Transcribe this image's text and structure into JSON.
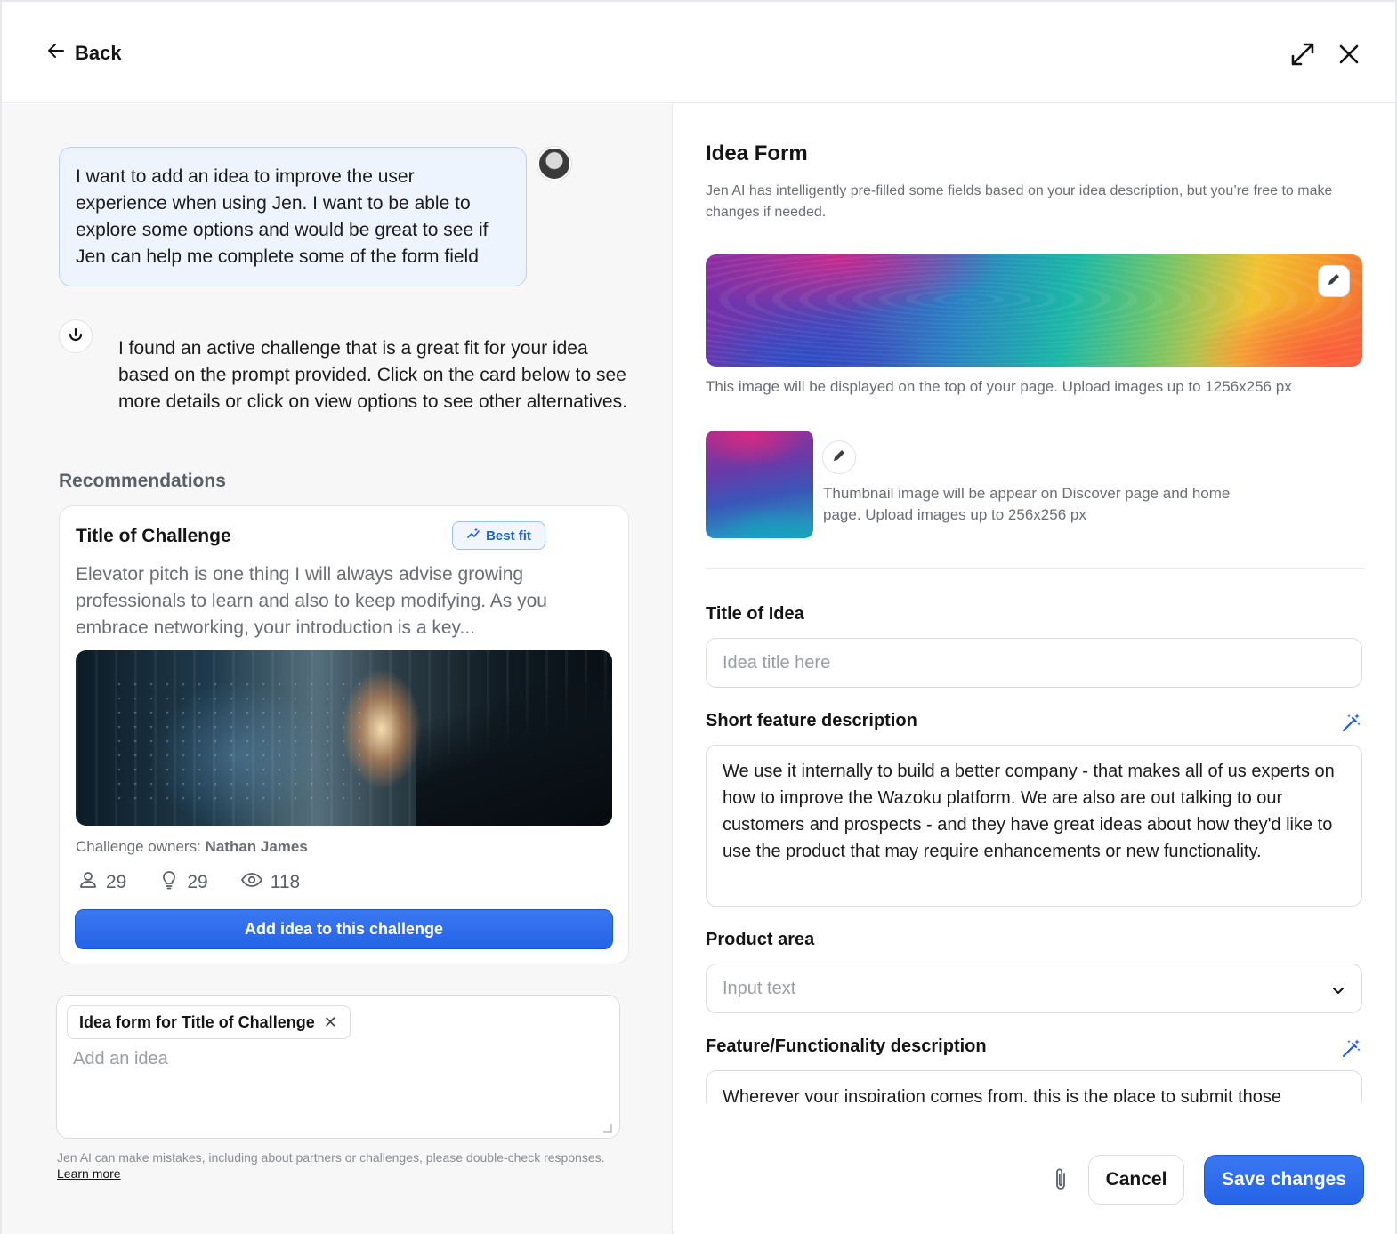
{
  "header": {
    "back_label": "Back",
    "icons": [
      "arrow-left-icon",
      "expand-icon",
      "close-icon"
    ]
  },
  "chat": {
    "user_message": "I want to add an idea to improve the user experience when using Jen. I want to be able to explore some options and would be great to see if Jen can help me complete some of the form field",
    "ai_message": "I found an active challenge that is a great fit for your idea based on the prompt provided. Click on the card below to see more details or click on view options to see other alternatives.",
    "recommendations_title": "Recommendations",
    "card": {
      "title": "Title of Challenge",
      "badge": "Best fit",
      "description": "Elevator pitch is one thing I will always advise growing professionals to learn and also to keep modifying. As you embrace networking, your introduction is a key...",
      "owners_label": "Challenge owners:",
      "owners_name": "Nathan James",
      "stats": {
        "participants": "29",
        "ideas": "29",
        "views": "118"
      },
      "button_label": "Add idea to this challenge"
    },
    "composer": {
      "chip_label": "Idea form for Title of Challenge",
      "placeholder": "Add an idea"
    },
    "disclaimer": "Jen AI can make mistakes, including about partners or challenges, please double-check responses.",
    "learn_more": "Learn more"
  },
  "form": {
    "title": "Idea Form",
    "subtitle": "Jen AI has intelligently pre-filled some fields based on your idea description, but you’re free to make changes if needed.",
    "banner_caption": "This image will be displayed on the top of your page. Upload images up to 1256x256 px",
    "thumbnail_caption": "Thumbnail image will be appear on Discover page and home page. Upload images up to 256x256 px",
    "fields": {
      "title_label": "Title of Idea",
      "title_placeholder": "Idea title here",
      "short_desc_label": "Short feature description",
      "short_desc_value": "We use it internally to build a better company - that makes all of us experts on how to improve the Wazoku platform. We are also are out talking to our customers and prospects - and they have great ideas about how they'd like to use the product that may require enhancements or new functionality.",
      "product_area_label": "Product area",
      "product_area_placeholder": "Input text",
      "feature_desc_label": "Feature/Functionality description",
      "feature_desc_value": "Wherever your inspiration comes from, this is the place to submit those"
    },
    "footer": {
      "cancel_label": "Cancel",
      "save_label": "Save changes"
    }
  },
  "colors": {
    "primary": "#2563e8",
    "bubble_bg": "#eef4fd",
    "bubble_border": "#b9d2f4",
    "muted_text": "#6b6e74"
  }
}
